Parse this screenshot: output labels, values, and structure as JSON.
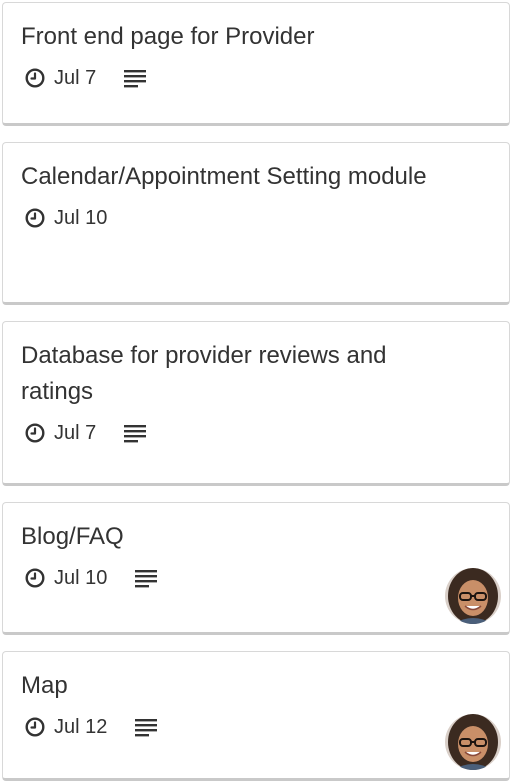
{
  "cards": [
    {
      "title": "Front end page for Provider",
      "due": "Jul 7",
      "has_description": true,
      "has_avatar": false
    },
    {
      "title": "Calendar/Appointment Setting module",
      "due": "Jul 10",
      "has_description": false,
      "has_avatar": false
    },
    {
      "title": "Database for provider reviews and ratings",
      "due": "Jul 7",
      "has_description": true,
      "has_avatar": false
    },
    {
      "title": "Blog/FAQ",
      "due": "Jul 10",
      "has_description": true,
      "has_avatar": true
    },
    {
      "title": "Map",
      "due": "Jul 12",
      "has_description": true,
      "has_avatar": true
    }
  ],
  "icons": {
    "due": "clock-icon",
    "description": "description-lines-icon",
    "member": "avatar"
  },
  "colors": {
    "text": "#333333",
    "card_border": "#d8d8d8",
    "card_shadow": "#c9c9c9",
    "background": "#ffffff"
  }
}
